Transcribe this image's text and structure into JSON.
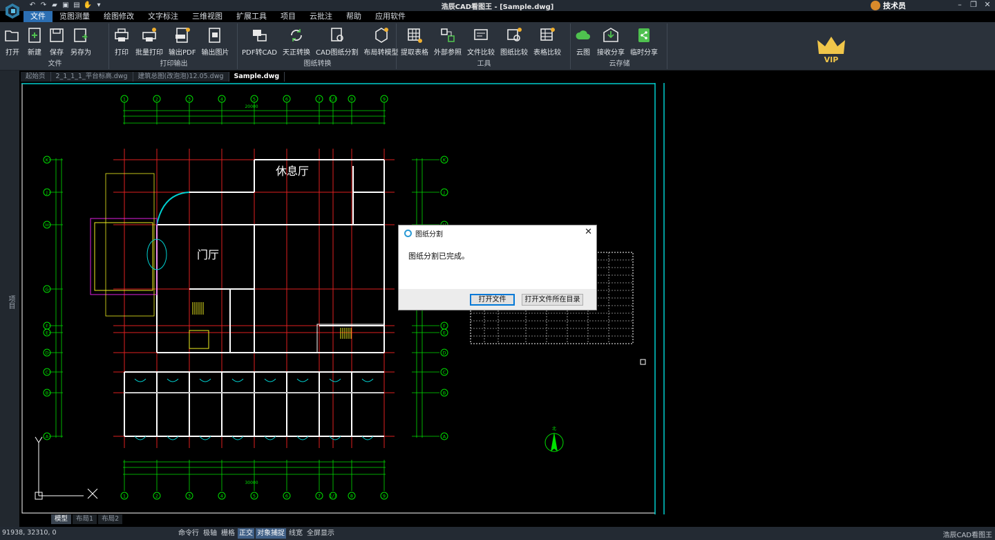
{
  "window": {
    "title": "浩辰CAD看图王 - [Sample.dwg]",
    "user_name": "技术员"
  },
  "menu": [
    "文件",
    "览图测量",
    "绘图修改",
    "文字标注",
    "三维视图",
    "扩展工具",
    "项目",
    "云批注",
    "帮助",
    "应用软件"
  ],
  "ribbon": {
    "file": {
      "label": "文件",
      "buttons": [
        "打开",
        "新建",
        "保存",
        "另存为"
      ]
    },
    "print": {
      "label": "打印输出",
      "buttons": [
        "打印",
        "批量打印",
        "输出PDF",
        "输出图片"
      ]
    },
    "convert": {
      "label": "图纸转换",
      "buttons": [
        "PDF转CAD",
        "天正转换",
        "CAD图纸分割",
        "布局转模型"
      ]
    },
    "tools": {
      "label": "工具",
      "buttons": [
        "提取表格",
        "外部参照",
        "文件比较",
        "图纸比较",
        "表格比较"
      ]
    },
    "cloud": {
      "label": "云存储",
      "buttons": [
        "云图",
        "接收分享",
        "临时分享"
      ]
    },
    "vip_label": "VIP"
  },
  "doc_tabs": [
    "起始页",
    "2_1_1_1_平台标高.dwg",
    "建筑总图(改泡泡)12.05.dwg",
    "Sample.dwg"
  ],
  "left_panel_label": "项目",
  "drawing": {
    "axis_cols": [
      "1",
      "2",
      "3",
      "4",
      "5",
      "6",
      "7",
      "1/7",
      "8",
      "9"
    ],
    "axis_rows": [
      "K",
      "J",
      "H",
      "G",
      "F",
      "E",
      "D",
      "C",
      "B",
      "A"
    ],
    "room_labels": {
      "lounge": "休息厅",
      "hall": "门厅"
    },
    "top_total": "20000",
    "bottom_total": "30000",
    "north_label": "北"
  },
  "dialog": {
    "title": "图纸分割",
    "message": "图纸分割已完成。",
    "open_file": "打开文件",
    "open_folder": "打开文件所在目录"
  },
  "layout_tabs": [
    "模型",
    "布局1",
    "布局2"
  ],
  "status": {
    "coords": "91938, 32310, 0",
    "toggles": [
      "命令行",
      "极轴",
      "栅格",
      "正交",
      "对象捕捉",
      "线宽",
      "全屏显示"
    ],
    "app_name": "浩辰CAD看图王"
  },
  "colors": {
    "accent": "#2c6fb3",
    "drawing_grid": "#e02020",
    "dims": "#00e000",
    "walls": "#ffffff",
    "cyan": "#00d0d0"
  }
}
